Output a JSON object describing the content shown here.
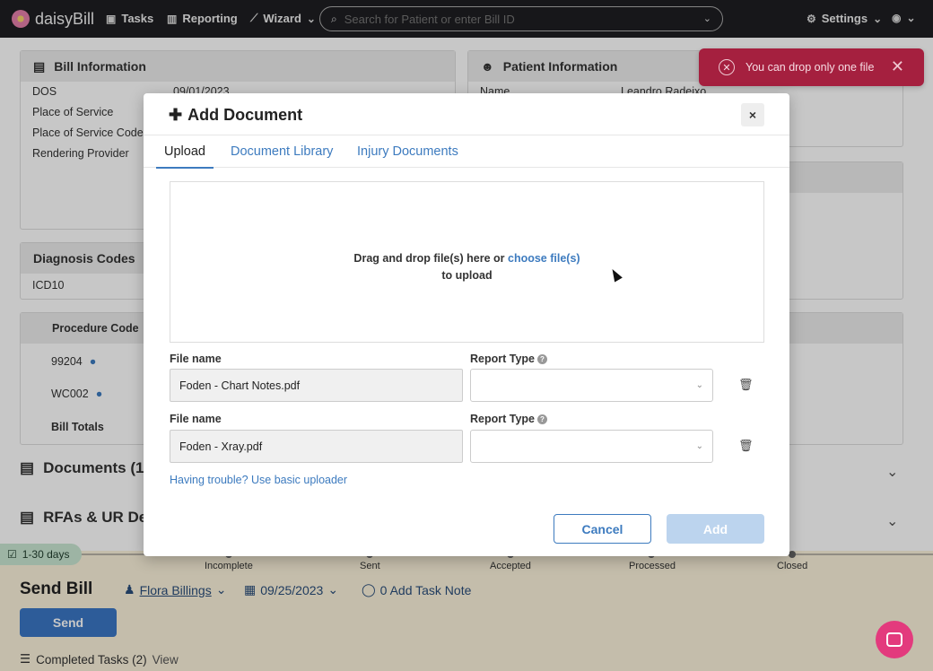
{
  "nav": {
    "brand": "daisyBill",
    "tasks": "Tasks",
    "reporting": "Reporting",
    "wizard": "Wizard",
    "search_placeholder": "Search for Patient or enter Bill ID",
    "settings": "Settings"
  },
  "background": {
    "bill_info_title": "Bill Information",
    "bill_rows": [
      {
        "label": "DOS",
        "value": "09/01/2023"
      },
      {
        "label": "Place of Service"
      },
      {
        "label": "Place of Service Code"
      },
      {
        "label": "Rendering Provider"
      }
    ],
    "patient_info_title": "Patient Information",
    "patient_row": {
      "label": "Name",
      "value": "Leandro Radeixo"
    },
    "diagnosis_title": "Diagnosis Codes",
    "diagnosis_row": "ICD10",
    "procedure_header": "Procedure Code",
    "procedure_rows": [
      "99204",
      "WC002"
    ],
    "bill_totals": "Bill Totals",
    "documents_title": "Documents (1)",
    "rfas_title": "RFAs & UR De"
  },
  "workflow": {
    "days_badge": "1-30 days",
    "steps": [
      "Incomplete",
      "Sent",
      "Accepted",
      "Processed",
      "Closed"
    ],
    "title": "Send Bill",
    "assignee": "Flora Billings",
    "date": "09/25/2023",
    "task_note": "0 Add Task Note",
    "send_button": "Send",
    "completed_tasks": "Completed Tasks (2)",
    "view_link": "View"
  },
  "toast": {
    "message": "You can drop only one file"
  },
  "modal": {
    "title": "Add Document",
    "close": "×",
    "tabs": [
      "Upload",
      "Document Library",
      "Injury Documents"
    ],
    "dropzone_text": "Drag and drop file(s) here or",
    "dropzone_link": "choose file(s)",
    "dropzone_text2": "to upload",
    "files": [
      {
        "name_label": "File name",
        "name": "Foden - Chart Notes.pdf",
        "type_label": "Report Type"
      },
      {
        "name_label": "File name",
        "name": "Foden - Xray.pdf",
        "type_label": "Report Type"
      }
    ],
    "trouble_link": "Having trouble? Use basic uploader",
    "cancel": "Cancel",
    "add": "Add"
  },
  "colors": {
    "nav_bg": "#1e1e22",
    "accent": "#3d7bbf",
    "toast_bg": "#a5203f",
    "chat_bg": "#e33a7d"
  }
}
